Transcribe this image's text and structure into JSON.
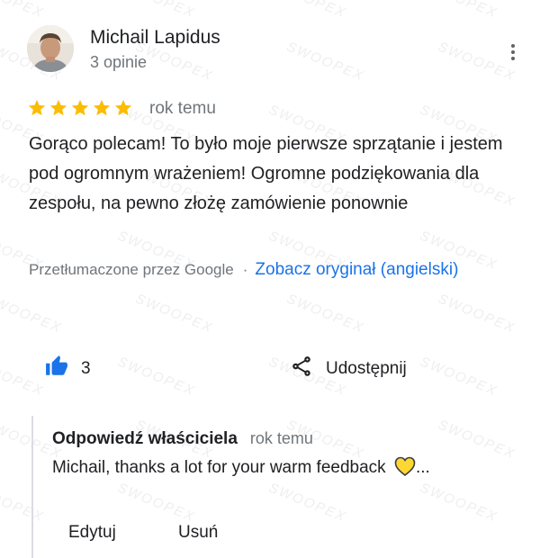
{
  "review": {
    "author_name": "Michail Lapidus",
    "author_reviews": "3 opinie",
    "rating": 5,
    "rating_max": 5,
    "date": "rok temu",
    "text": "Gorąco polecam! To było moje pierwsze sprzątanie i jestem pod ogromnym wrażeniem! Ogromne podziękowania dla zespołu, na pewno złożę zamówienie ponownie",
    "translated_by": "Przetłumaczone przez Google",
    "separator": "·",
    "see_original": "Zobacz oryginał (angielski)",
    "likes": "3",
    "share_label": "Udostępnij"
  },
  "owner_reply": {
    "title": "Odpowiedź właściciela",
    "date": "rok temu",
    "text": "Michail, thanks a lot for your warm feedback",
    "ellipsis": "...",
    "edit_label": "Edytuj",
    "delete_label": "Usuń"
  },
  "watermark": "SWOOPEX",
  "icons": {
    "avatar": "avatar-photo",
    "more": "more-vert-icon",
    "star": "star-icon",
    "like": "thumb-up-icon",
    "share": "share-icon",
    "heart": "yellow-heart-emoji"
  },
  "colors": {
    "star": "#fbbc04",
    "link": "#1a73e8",
    "thumb": "#1a73e8",
    "heart": "#fdd835",
    "muted": "#70757a"
  }
}
